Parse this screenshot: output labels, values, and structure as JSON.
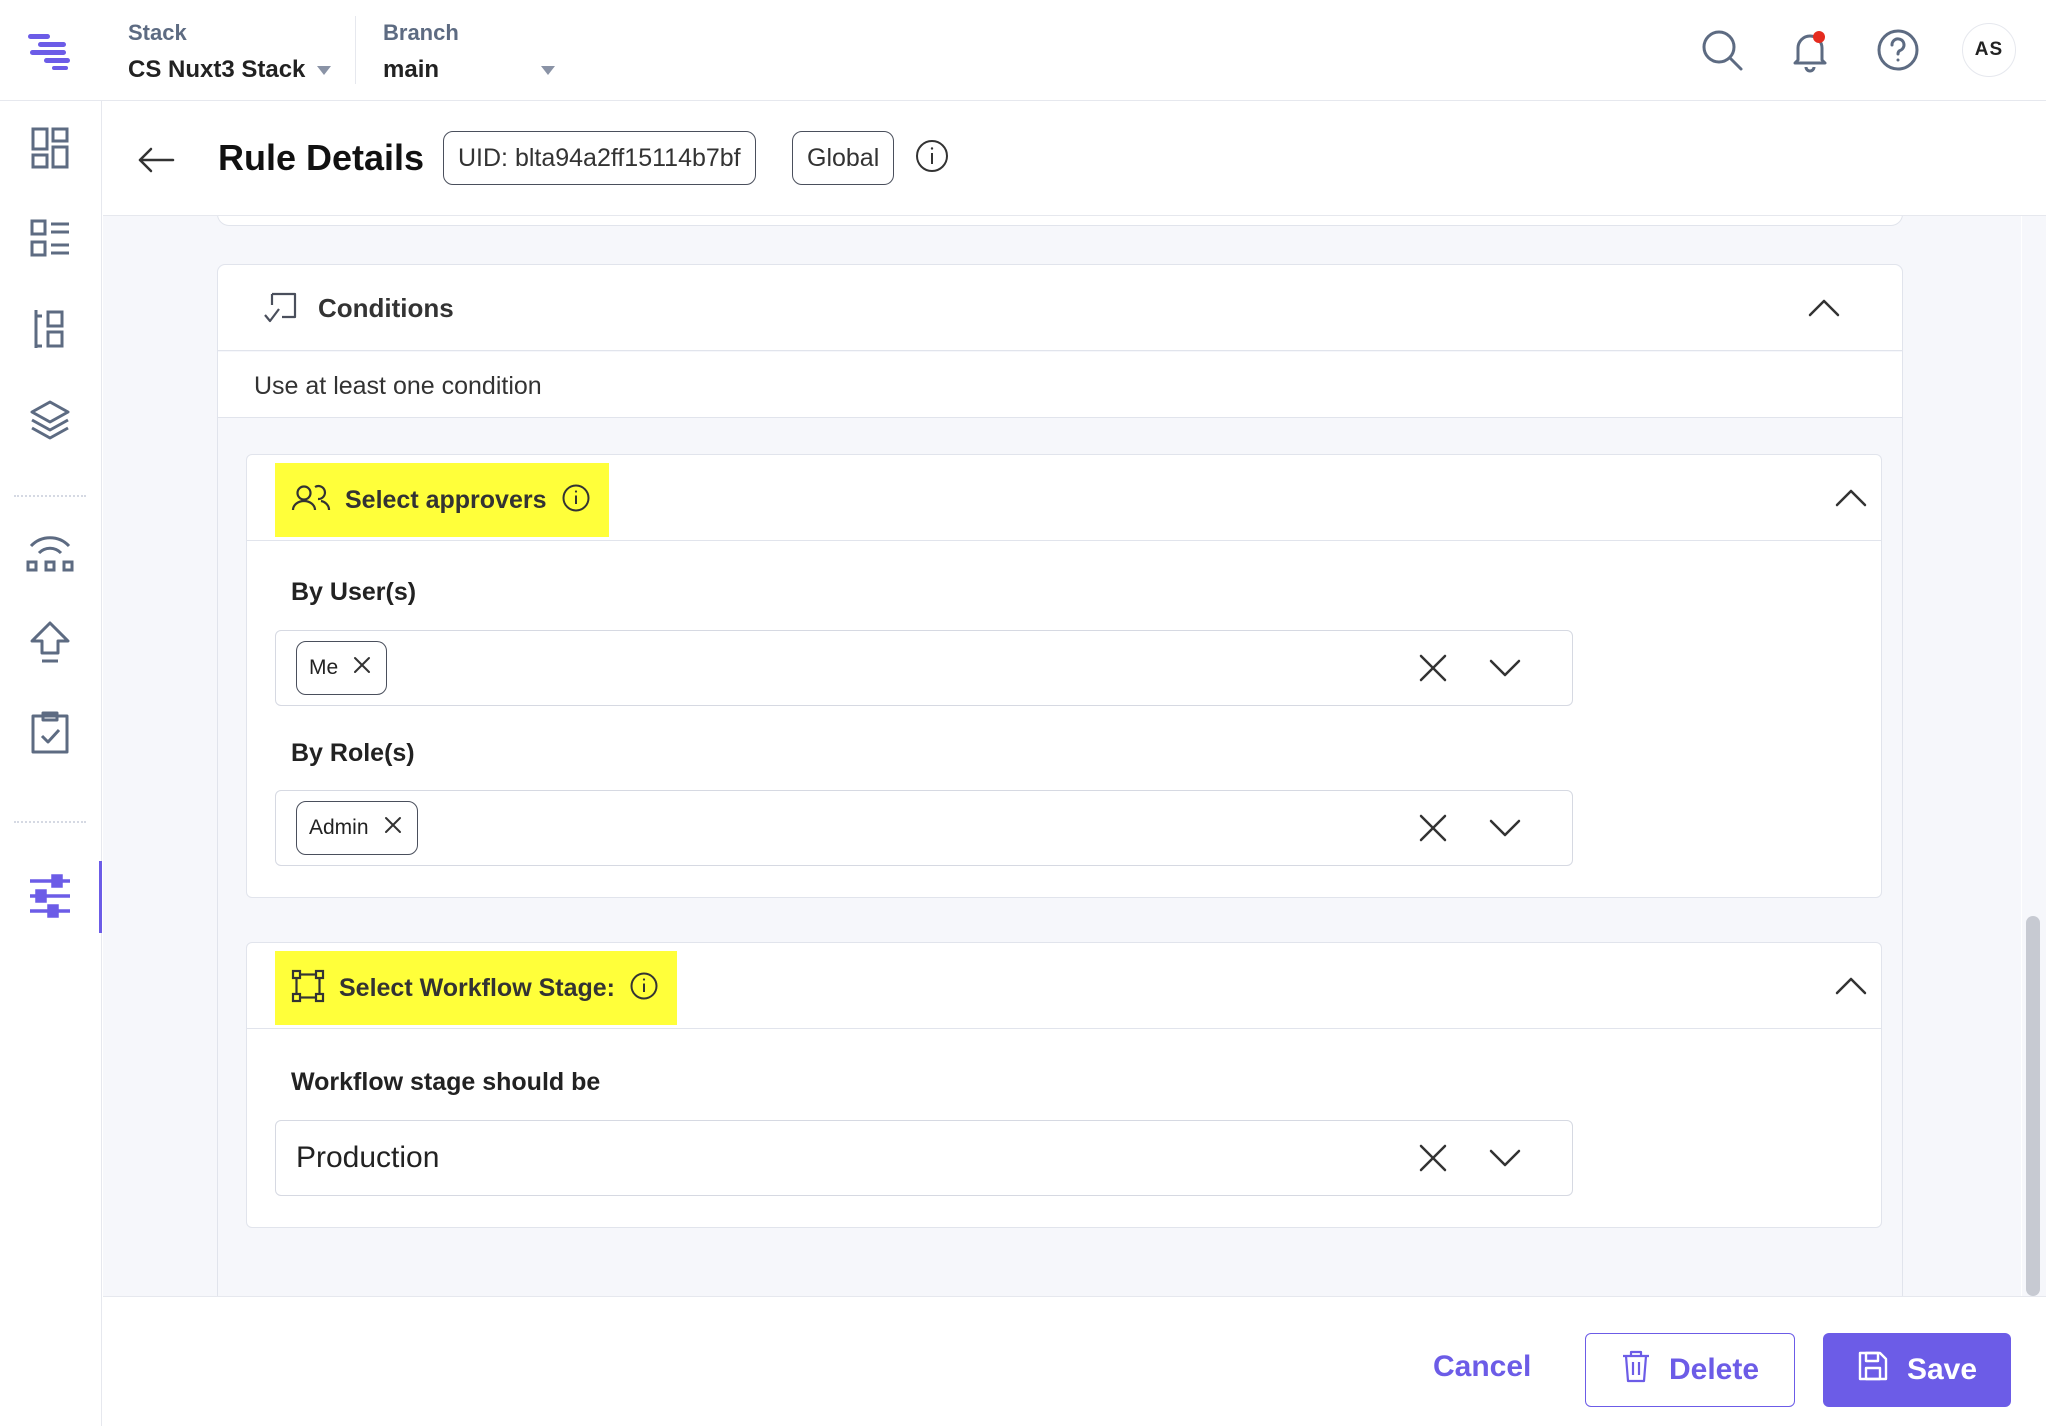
{
  "topbar": {
    "stack_label": "Stack",
    "stack_value": "CS Nuxt3 Stack",
    "branch_label": "Branch",
    "branch_value": "main",
    "avatar_initials": "AS",
    "has_notification": true
  },
  "sidebar": {
    "items": [
      {
        "icon": "dashboard-icon"
      },
      {
        "icon": "content-models-icon"
      },
      {
        "icon": "entries-icon"
      },
      {
        "icon": "assets-layers-icon"
      },
      {
        "icon": "releases-icon"
      },
      {
        "icon": "publish-queue-icon"
      },
      {
        "icon": "tasks-icon"
      },
      {
        "icon": "settings-sliders-icon",
        "active": true
      }
    ]
  },
  "header": {
    "title": "Rule Details",
    "uid": "UID: blta94a2ff15114b7bf",
    "scope": "Global"
  },
  "conditions": {
    "title": "Conditions",
    "subtitle": "Use at least one condition",
    "approvers": {
      "title": "Select approvers",
      "by_users_label": "By User(s)",
      "users": [
        "Me"
      ],
      "by_roles_label": "By Role(s)",
      "roles": [
        "Admin"
      ]
    },
    "workflow": {
      "title": "Select Workflow Stage:",
      "stage_label": "Workflow stage should be",
      "stage_value": "Production"
    }
  },
  "footer": {
    "cancel_label": "Cancel",
    "delete_label": "Delete",
    "save_label": "Save"
  },
  "colors": {
    "accent": "#6c5ce7",
    "highlight": "#ffff3a",
    "notification": "#e52b1e"
  }
}
